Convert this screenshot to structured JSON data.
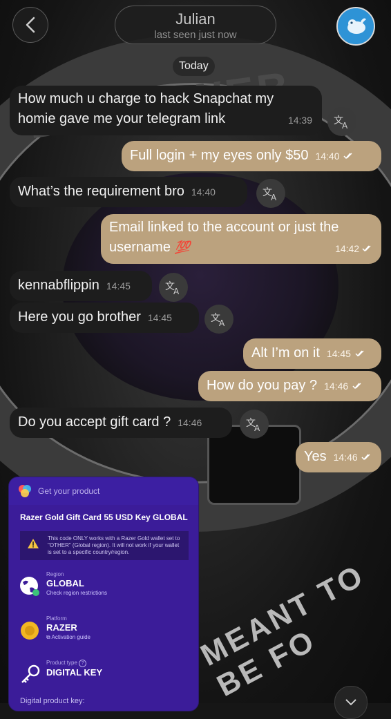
{
  "header": {
    "contact_name": "Julian",
    "status": "last seen just now",
    "date_divider": "Today"
  },
  "messages": [
    {
      "dir": "in",
      "line1": "How much u charge to hack Snapchat my",
      "line2": "homie gave me your telegram link",
      "time": "14:39"
    },
    {
      "dir": "out",
      "text": "Full login + my eyes only $50",
      "time": "14:40"
    },
    {
      "dir": "in",
      "text": "What’s the requirement bro",
      "time": "14:40"
    },
    {
      "dir": "out",
      "line1": "Email linked to the account or just the",
      "line2": "username",
      "emoji": "💯",
      "time": "14:42"
    },
    {
      "dir": "in",
      "text": "kennabflippin",
      "time": "14:45"
    },
    {
      "dir": "in",
      "text": "Here you go brother",
      "time": "14:45"
    },
    {
      "dir": "out",
      "text": "Alt I’m on it",
      "time": "14:45"
    },
    {
      "dir": "out",
      "text": "How do you pay ?",
      "time": "14:46"
    },
    {
      "dir": "in",
      "text": "Do you accept gift card ?",
      "time": "14:46"
    },
    {
      "dir": "out",
      "text": "Yes",
      "time": "14:46"
    }
  ],
  "background_text": {
    "top_arc": "DARK WEB",
    "bottom_arc": "MEANT TO BE FO"
  },
  "product_card": {
    "header_label": "Get your product",
    "title": "Razer Gold Gift Card 55 USD Key GLOBAL",
    "notice": "This code ONLY works with a Razer Gold wallet set to \"OTHER\" (Global region). It will not work if your wallet is set to a specific country/region.",
    "region_label": "Region",
    "region_value": "GLOBAL",
    "region_link": "Check region restrictions",
    "platform_label": "Platform",
    "platform_value": "RAZER",
    "platform_link": "Activation guide",
    "type_label": "Product type",
    "type_value": "DIGITAL KEY",
    "footer": "Digital product key:"
  },
  "colors": {
    "incoming_bubble": "#1d1d1d",
    "outgoing_bubble": "#bba27e",
    "card_purple": "#3b1c99"
  },
  "icons": [
    "back-chevron-icon",
    "translate-icon",
    "double-check-icon",
    "warning-icon",
    "globe-icon",
    "razer-icon",
    "key-icon",
    "help-icon",
    "chevron-down-icon"
  ]
}
